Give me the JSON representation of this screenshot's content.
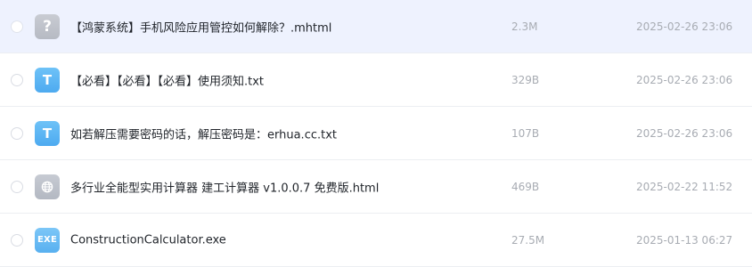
{
  "files": [
    {
      "name": "【鸿蒙系统】手机风险应用管控如何解除？.mhtml",
      "size": "2.3M",
      "date": "2025-02-26 23:06",
      "icon": "question-icon",
      "icon_text": "?",
      "selected": true
    },
    {
      "name": "【必看】【必看】【必看】使用须知.txt",
      "size": "329B",
      "date": "2025-02-26 23:06",
      "icon": "txt-file-icon",
      "icon_text": "T",
      "selected": false
    },
    {
      "name": "如若解压需要密码的话，解压密码是：erhua.cc.txt",
      "size": "107B",
      "date": "2025-02-26 23:06",
      "icon": "txt-file-icon",
      "icon_text": "T",
      "selected": false
    },
    {
      "name": "多行业全能型实用计算器 建工计算器 v1.0.0.7 免费版.html",
      "size": "469B",
      "date": "2025-02-22 11:52",
      "icon": "globe-icon",
      "icon_text": "",
      "selected": false
    },
    {
      "name": "ConstructionCalculator.exe",
      "size": "27.5M",
      "date": "2025-01-13 06:27",
      "icon": "exe-file-icon",
      "icon_text": "EXE",
      "selected": false
    }
  ],
  "colors": {
    "selected_row_bg": "#eef2fe",
    "text_primary": "#1f2329",
    "text_secondary": "#a8acb3",
    "txt_icon": "#5ab4f3",
    "unknown_icon": "#bfc3cb"
  }
}
